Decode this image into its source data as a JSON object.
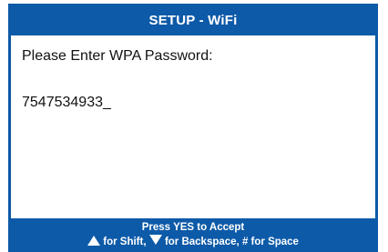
{
  "colors": {
    "accent": "#0d5aa8",
    "background": "#ffffff",
    "text": "#111111"
  },
  "header": {
    "title": "SETUP - WiFi"
  },
  "main": {
    "prompt": "Please Enter WPA Password:",
    "entry_value": "7547534933_"
  },
  "footer": {
    "line1": "Press YES to Accept",
    "shift_text": "for Shift,",
    "backspace_text": "for Backspace, # for Space",
    "shift_icon": "up-triangle-icon",
    "backspace_icon": "down-triangle-icon"
  }
}
